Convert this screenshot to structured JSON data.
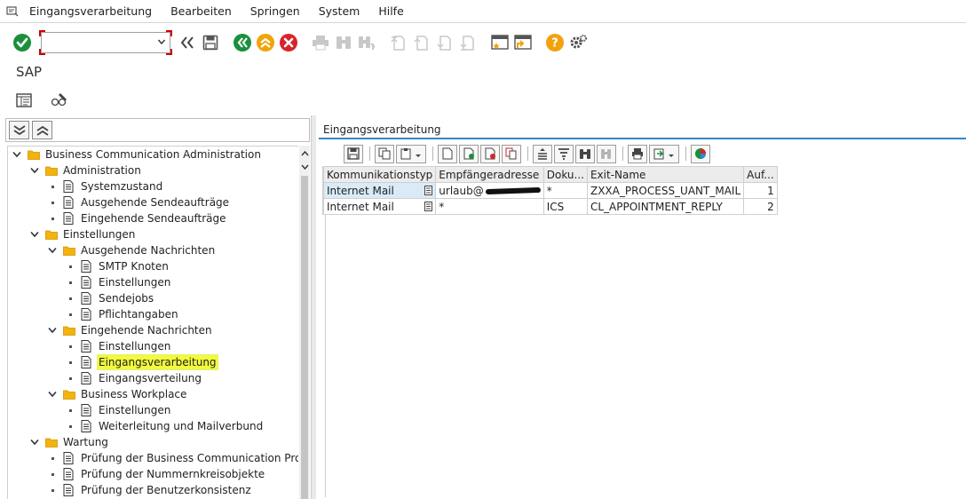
{
  "menu": {
    "items": [
      "Eingangsverarbeitung",
      "Bearbeiten",
      "Springen",
      "System",
      "Hilfe"
    ]
  },
  "toolbar": {
    "command_value": "",
    "icons": [
      "enter-icon",
      "back-icon",
      "save-icon",
      "back-green-icon",
      "exit-icon",
      "cancel-icon",
      "print-icon",
      "find-icon",
      "find-next-icon",
      "first-page-icon",
      "previous-page-icon",
      "next-page-icon",
      "last-page-icon",
      "create-session-icon",
      "shortcut-icon",
      "help-icon",
      "customize-icon"
    ]
  },
  "title": "SAP",
  "nav": {
    "tree": [
      {
        "label": "Business Communication Administration",
        "level": 0,
        "kind": "folder",
        "expanded": true
      },
      {
        "label": "Administration",
        "level": 1,
        "kind": "folder",
        "expanded": true
      },
      {
        "label": "Systemzustand",
        "level": 2,
        "kind": "doc"
      },
      {
        "label": "Ausgehende Sendeaufträge",
        "level": 2,
        "kind": "doc"
      },
      {
        "label": "Eingehende Sendeaufträge",
        "level": 2,
        "kind": "doc"
      },
      {
        "label": "Einstellungen",
        "level": 1,
        "kind": "folder",
        "expanded": true
      },
      {
        "label": "Ausgehende Nachrichten",
        "level": 2,
        "kind": "folder",
        "expanded": true
      },
      {
        "label": "SMTP Knoten",
        "level": 3,
        "kind": "doc"
      },
      {
        "label": "Einstellungen",
        "level": 3,
        "kind": "doc"
      },
      {
        "label": "Sendejobs",
        "level": 3,
        "kind": "doc"
      },
      {
        "label": "Pflichtangaben",
        "level": 3,
        "kind": "doc"
      },
      {
        "label": "Eingehende Nachrichten",
        "level": 2,
        "kind": "folder",
        "expanded": true
      },
      {
        "label": "Einstellungen",
        "level": 3,
        "kind": "doc"
      },
      {
        "label": "Eingangsverarbeitung",
        "level": 3,
        "kind": "doc",
        "highlighted": true
      },
      {
        "label": "Eingangsverteilung",
        "level": 3,
        "kind": "doc"
      },
      {
        "label": "Business Workplace",
        "level": 2,
        "kind": "folder",
        "expanded": true
      },
      {
        "label": "Einstellungen",
        "level": 3,
        "kind": "doc"
      },
      {
        "label": "Weiterleitung und Mailverbund",
        "level": 3,
        "kind": "doc"
      },
      {
        "label": "Wartung",
        "level": 1,
        "kind": "folder",
        "expanded": true
      },
      {
        "label": "Prüfung der Business Communication Profile",
        "level": 2,
        "kind": "doc"
      },
      {
        "label": "Prüfung der Nummernkreisobjekte",
        "level": 2,
        "kind": "doc"
      },
      {
        "label": "Prüfung der Benutzerkonsistenz",
        "level": 2,
        "kind": "doc"
      }
    ]
  },
  "content": {
    "title": "Eingangsverarbeitung",
    "columns": [
      "Kommunikationstyp",
      "Empfängeradresse",
      "Doku...",
      "Exit-Name",
      "Auf..."
    ],
    "rows": [
      {
        "kommunikationstyp": "Internet Mail",
        "empfaenger": "urlaub@",
        "empfaenger_redacted": true,
        "doku": "*",
        "exit_name": "ZXXA_PROCESS_UANT_MAIL",
        "auf": "1"
      },
      {
        "kommunikationstyp": "Internet Mail",
        "empfaenger": "*",
        "empfaenger_redacted": false,
        "doku": "ICS",
        "exit_name": "CL_APPOINTMENT_REPLY",
        "auf": "2"
      }
    ]
  },
  "colors": {
    "highlight": "#f2fb3c",
    "accent": "#2f88c7",
    "ok_green": "#1a8f3c",
    "exit_orange": "#f0a30a",
    "cancel_red": "#d8232a",
    "help_orange": "#f2a20c"
  }
}
